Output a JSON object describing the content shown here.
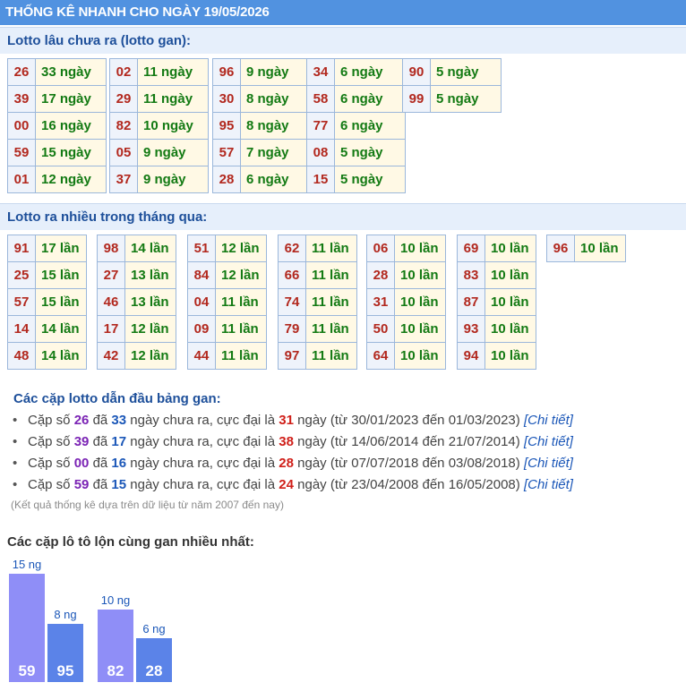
{
  "header": {
    "title": "THỐNG KÊ NHANH CHO NGÀY 19/05/2026"
  },
  "gan_section": {
    "title": "Lotto lâu chưa ra (lotto gan):",
    "columns": [
      [
        {
          "num": "26",
          "val": "33 ngày"
        },
        {
          "num": "39",
          "val": "17 ngày"
        },
        {
          "num": "00",
          "val": "16 ngày"
        },
        {
          "num": "59",
          "val": "15 ngày"
        },
        {
          "num": "01",
          "val": "12 ngày"
        }
      ],
      [
        {
          "num": "02",
          "val": "11 ngày"
        },
        {
          "num": "29",
          "val": "11 ngày"
        },
        {
          "num": "82",
          "val": "10 ngày"
        },
        {
          "num": "05",
          "val": "9 ngày"
        },
        {
          "num": "37",
          "val": "9 ngày"
        }
      ],
      [
        {
          "num": "96",
          "val": "9 ngày"
        },
        {
          "num": "30",
          "val": "8 ngày"
        },
        {
          "num": "95",
          "val": "8 ngày"
        },
        {
          "num": "57",
          "val": "7 ngày"
        },
        {
          "num": "28",
          "val": "6 ngày"
        }
      ],
      [
        {
          "num": "34",
          "val": "6 ngày"
        },
        {
          "num": "58",
          "val": "6 ngày"
        },
        {
          "num": "77",
          "val": "6 ngày"
        },
        {
          "num": "08",
          "val": "5 ngày"
        },
        {
          "num": "15",
          "val": "5 ngày"
        }
      ],
      [
        {
          "num": "90",
          "val": "5 ngày"
        },
        {
          "num": "99",
          "val": "5 ngày"
        }
      ]
    ]
  },
  "freq_section": {
    "title": "Lotto ra nhiều trong tháng qua:",
    "columns": [
      [
        {
          "num": "91",
          "val": "17 lần"
        },
        {
          "num": "25",
          "val": "15 lần"
        },
        {
          "num": "57",
          "val": "15 lần"
        },
        {
          "num": "14",
          "val": "14 lần"
        },
        {
          "num": "48",
          "val": "14 lần"
        }
      ],
      [
        {
          "num": "98",
          "val": "14 lần"
        },
        {
          "num": "27",
          "val": "13 lần"
        },
        {
          "num": "46",
          "val": "13 lần"
        },
        {
          "num": "17",
          "val": "12 lần"
        },
        {
          "num": "42",
          "val": "12 lần"
        }
      ],
      [
        {
          "num": "51",
          "val": "12 lần"
        },
        {
          "num": "84",
          "val": "12 lần"
        },
        {
          "num": "04",
          "val": "11 lần"
        },
        {
          "num": "09",
          "val": "11 lần"
        },
        {
          "num": "44",
          "val": "11 lần"
        }
      ],
      [
        {
          "num": "62",
          "val": "11 lần"
        },
        {
          "num": "66",
          "val": "11 lần"
        },
        {
          "num": "74",
          "val": "11 lần"
        },
        {
          "num": "79",
          "val": "11 lần"
        },
        {
          "num": "97",
          "val": "11 lần"
        }
      ],
      [
        {
          "num": "06",
          "val": "10 lần"
        },
        {
          "num": "28",
          "val": "10 lần"
        },
        {
          "num": "31",
          "val": "10 lần"
        },
        {
          "num": "50",
          "val": "10 lần"
        },
        {
          "num": "64",
          "val": "10 lần"
        }
      ],
      [
        {
          "num": "69",
          "val": "10 lần"
        },
        {
          "num": "83",
          "val": "10 lần"
        },
        {
          "num": "87",
          "val": "10 lần"
        },
        {
          "num": "93",
          "val": "10 lần"
        },
        {
          "num": "94",
          "val": "10 lần"
        }
      ],
      [
        {
          "num": "96",
          "val": "10 lần"
        }
      ]
    ]
  },
  "pairs": {
    "title": "Các cặp lotto dẫn đầu bảng gan:",
    "items": [
      {
        "pair": "26",
        "days": "33",
        "max": "31",
        "from": "30/01/2023",
        "to": "01/03/2023"
      },
      {
        "pair": "39",
        "days": "17",
        "max": "38",
        "from": "14/06/2014",
        "to": "21/07/2014"
      },
      {
        "pair": "00",
        "days": "16",
        "max": "28",
        "from": "07/07/2018",
        "to": "03/08/2018"
      },
      {
        "pair": "59",
        "days": "15",
        "max": "24",
        "from": "23/04/2008",
        "to": "16/05/2008"
      }
    ],
    "text": {
      "prefix": "Cặp số",
      "da": "đã",
      "mid": "ngày chưa ra, cực đại là",
      "ngay": "ngày",
      "tu": "(từ",
      "den": "đến",
      "close": ")",
      "link": "[Chi tiết]"
    },
    "note": "(Kết quả thống kê dựa trên dữ liệu từ năm 2007 đến nay)"
  },
  "chart_section": {
    "title": "Các cặp lô tô lộn cùng gan nhiều nhất:"
  },
  "chart_data": {
    "type": "bar",
    "categories": [
      "59",
      "95",
      "82",
      "28"
    ],
    "values": [
      15,
      8,
      10,
      6
    ],
    "value_labels": [
      "15 ng",
      "8 ng",
      "10 ng",
      "6 ng"
    ],
    "colors": [
      "#8f8ef7",
      "#5b83e8",
      "#8f8ef7",
      "#5b83e8"
    ]
  }
}
